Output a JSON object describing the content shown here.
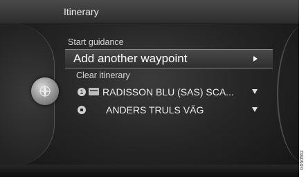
{
  "header": {
    "title": "Itinerary"
  },
  "menu": {
    "start_guidance": "Start guidance",
    "add_waypoint": "Add another waypoint",
    "clear_itinerary": "Clear itinerary",
    "waypoints": [
      {
        "index": "1",
        "icon": "hotel-icon",
        "label": "RADISSON BLU (SAS) SCA..."
      },
      {
        "index": "",
        "icon": "destination-flag-icon",
        "label": "ANDERS TRULS VÄG"
      }
    ]
  },
  "knob": {
    "icon": "compass-icon"
  },
  "image_code": "G050562"
}
